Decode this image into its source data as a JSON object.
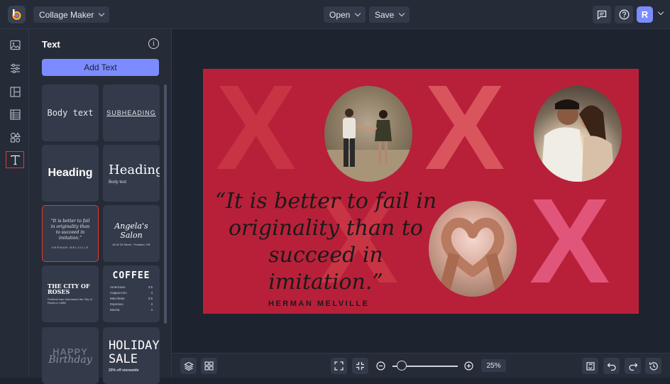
{
  "topbar": {
    "app_menu_label": "Collage Maker",
    "open_label": "Open",
    "save_label": "Save",
    "avatar_initial": "R"
  },
  "rail": {
    "items": [
      "image-icon",
      "adjustments-icon",
      "layout-icon",
      "texture-icon",
      "graphics-icon",
      "text-icon"
    ],
    "active": "text-icon"
  },
  "panel": {
    "title": "Text",
    "add_text_label": "Add Text",
    "tiles": [
      {
        "text": "Body text"
      },
      {
        "text": "SUBHEADING"
      },
      {
        "text": "Heading"
      },
      {
        "text": "Heading",
        "sub": "Body text"
      },
      {
        "text": "“It is better to fail in originality than to succeed in imitation.”",
        "sub": "HERMAN MELVILLE"
      },
      {
        "text": "Angela's Salon",
        "sub": "45 W 33 Street · Portland, OR"
      },
      {
        "text": "THE CITY OF ROSES",
        "sub": "Portland was nicknamed the City of Roses in 1888"
      },
      {
        "text": "COFFEE",
        "menu": [
          [
            "Americano",
            "3.5"
          ],
          [
            "Cappuccino",
            "4"
          ],
          [
            "Macchiato",
            "3.5"
          ],
          [
            "Espresso",
            "3"
          ],
          [
            "Mocha",
            "4"
          ]
        ]
      },
      {
        "text": "HAPPY",
        "sub": "Birthday"
      },
      {
        "text": "HOLIDAY SALE",
        "sub": "20% off storewide"
      }
    ]
  },
  "canvas": {
    "quote": "“It is better to fail in originality than to succeed in imitation.”",
    "author": "HERMAN MELVILLE",
    "letters": [
      "X",
      "O",
      "X",
      "O",
      "X",
      "O"
    ],
    "colors": {
      "background": "#b8203a",
      "x_light": "#d9545c",
      "x_pink": "#e2557a"
    }
  },
  "bottombar": {
    "zoom": "25%"
  },
  "colors": {
    "accent": "#7c8cff",
    "selection": "#e23b2e"
  }
}
